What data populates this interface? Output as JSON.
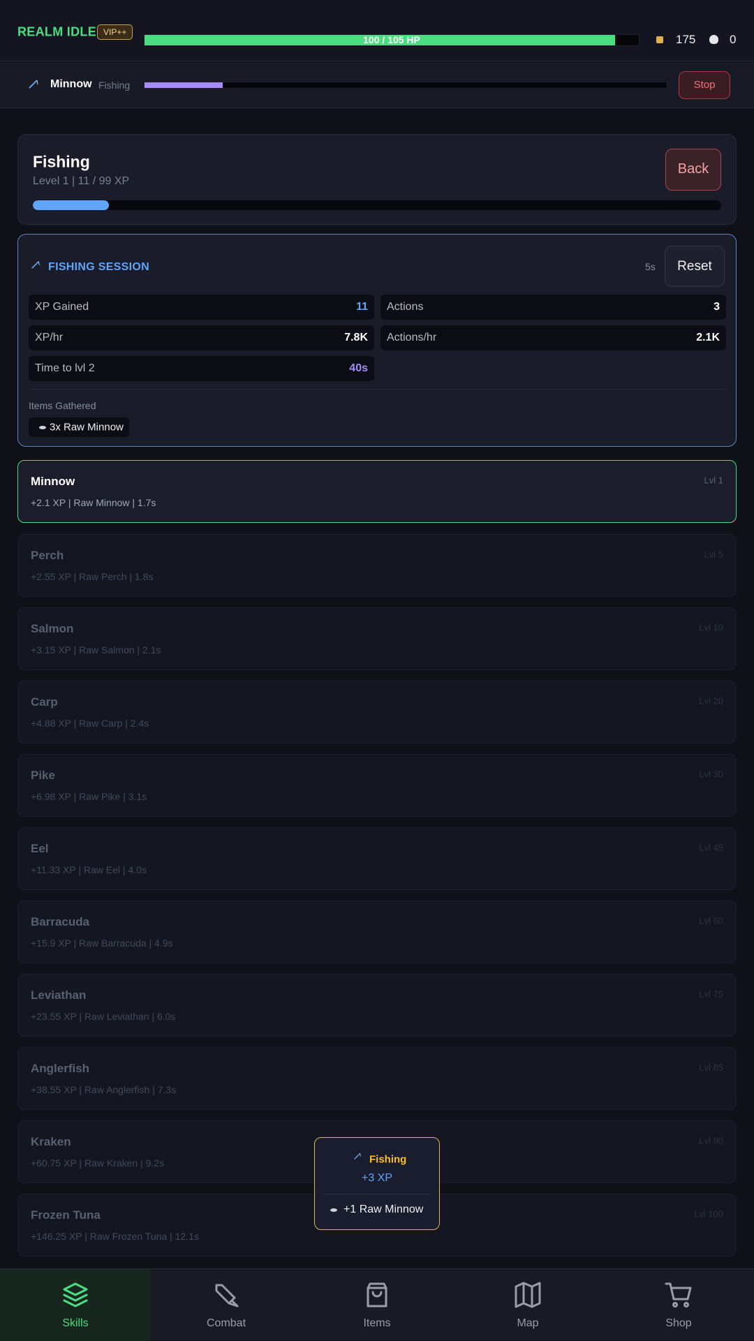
{
  "header": {
    "brand": "REALM IDLE",
    "vip_badge": "VIP++",
    "hp_text": "100 / 105 HP",
    "hp_fraction": 0.952,
    "gold": "175",
    "kills": "0",
    "colors": {
      "brand": "#4ade80",
      "hp": "#4ade80"
    }
  },
  "activity": {
    "icon": "fishing-rod-icon",
    "name": "Minnow",
    "skill": "Fishing",
    "progress_fraction": 0.15,
    "stop_label": "Stop"
  },
  "skill": {
    "title": "Fishing",
    "subtitle": "Level 1 | 11 / 99 XP",
    "progress_fraction": 0.111,
    "back_label": "Back"
  },
  "session": {
    "icon": "fishing-rod-icon",
    "title": "FISHING SESSION",
    "elapsed": "5s",
    "reset_label": "Reset",
    "stats": {
      "xp_gained": {
        "label": "XP Gained",
        "value": "11",
        "color": "#60a5fa"
      },
      "actions": {
        "label": "Actions",
        "value": "3",
        "color": "#ffffff"
      },
      "xp_hr": {
        "label": "XP/hr",
        "value": "7.8K",
        "color": "#ffffff"
      },
      "actions_hr": {
        "label": "Actions/hr",
        "value": "2.1K",
        "color": "#ffffff"
      },
      "time_to_lvl": {
        "label": "Time to lvl 2",
        "value": "40s",
        "color": "#a78bfa"
      }
    },
    "items_label": "Items Gathered",
    "items": [
      "3x Raw Minnow"
    ]
  },
  "fish": [
    {
      "name": "Minnow",
      "info": "+2.1 XP | Raw Minnow | 1.7s",
      "level": "Lvl 1",
      "active": true
    },
    {
      "name": "Perch",
      "info": "+2.55 XP | Raw Perch | 1.8s",
      "level": "Lvl 5",
      "active": false
    },
    {
      "name": "Salmon",
      "info": "+3.15 XP | Raw Salmon | 2.1s",
      "level": "Lvl 10",
      "active": false
    },
    {
      "name": "Carp",
      "info": "+4.88 XP | Raw Carp | 2.4s",
      "level": "Lvl 20",
      "active": false
    },
    {
      "name": "Pike",
      "info": "+6.98 XP | Raw Pike | 3.1s",
      "level": "Lvl 30",
      "active": false
    },
    {
      "name": "Eel",
      "info": "+11.33 XP | Raw Eel | 4.0s",
      "level": "Lvl 45",
      "active": false
    },
    {
      "name": "Barracuda",
      "info": "+15.9 XP | Raw Barracuda | 4.9s",
      "level": "Lvl 60",
      "active": false
    },
    {
      "name": "Leviathan",
      "info": "+23.55 XP | Raw Leviathan | 6.0s",
      "level": "Lvl 75",
      "active": false
    },
    {
      "name": "Anglerfish",
      "info": "+38.55 XP | Raw Anglerfish | 7.3s",
      "level": "Lvl 85",
      "active": false
    },
    {
      "name": "Kraken",
      "info": "+60.75 XP | Raw Kraken | 9.2s",
      "level": "Lvl 90",
      "active": false
    },
    {
      "name": "Frozen Tuna",
      "info": "+146.25 XP | Raw Frozen Tuna | 12.1s",
      "level": "Lvl 100",
      "active": false
    }
  ],
  "toast": {
    "icon": "fishing-rod-icon",
    "title": "Fishing",
    "xp": "+3 XP",
    "item": "+1 Raw Minnow",
    "color": "#fbbf24"
  },
  "nav": [
    {
      "label": "Skills",
      "icon": "layers-icon",
      "active": true
    },
    {
      "label": "Combat",
      "icon": "sword-icon",
      "active": false
    },
    {
      "label": "Items",
      "icon": "bag-icon",
      "active": false
    },
    {
      "label": "Map",
      "icon": "map-icon",
      "active": false
    },
    {
      "label": "Shop",
      "icon": "cart-icon",
      "active": false
    }
  ]
}
